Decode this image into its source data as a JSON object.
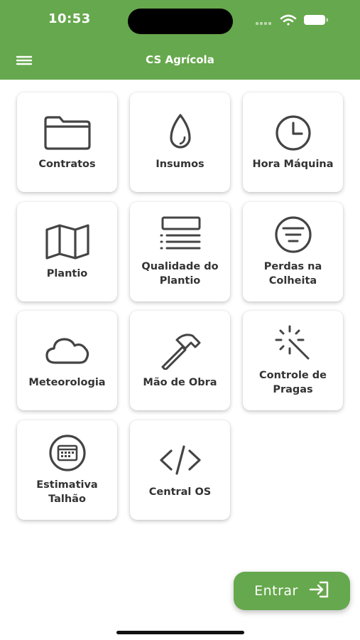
{
  "status_bar": {
    "time": "10:53"
  },
  "header": {
    "title": "CS Agrícola",
    "menu_icon": "hamburger-menu-icon",
    "background": "#66a84d"
  },
  "tiles": [
    {
      "label": "Contratos",
      "icon": "folder-icon"
    },
    {
      "label": "Insumos",
      "icon": "drop-icon"
    },
    {
      "label": "Hora Máquina",
      "icon": "clock-icon"
    },
    {
      "label": "Plantio",
      "icon": "map-icon"
    },
    {
      "label": "Qualidade do Plantio",
      "icon": "list-icon"
    },
    {
      "label": "Perdas na Colheita",
      "icon": "filter-circle-icon"
    },
    {
      "label": "Meteorologia",
      "icon": "cloud-icon"
    },
    {
      "label": "Mão de Obra",
      "icon": "hammer-icon"
    },
    {
      "label": "Controle de Pragas",
      "icon": "magic-wand-icon"
    },
    {
      "label": "Estimativa Talhão",
      "icon": "calendar-circle-icon"
    },
    {
      "label": "Central OS",
      "icon": "code-icon"
    }
  ],
  "enter_button": {
    "label": "Entrar",
    "icon": "login-icon"
  },
  "colors": {
    "accent": "#66a84d",
    "icon_stroke": "#444444",
    "text": "#333333"
  }
}
